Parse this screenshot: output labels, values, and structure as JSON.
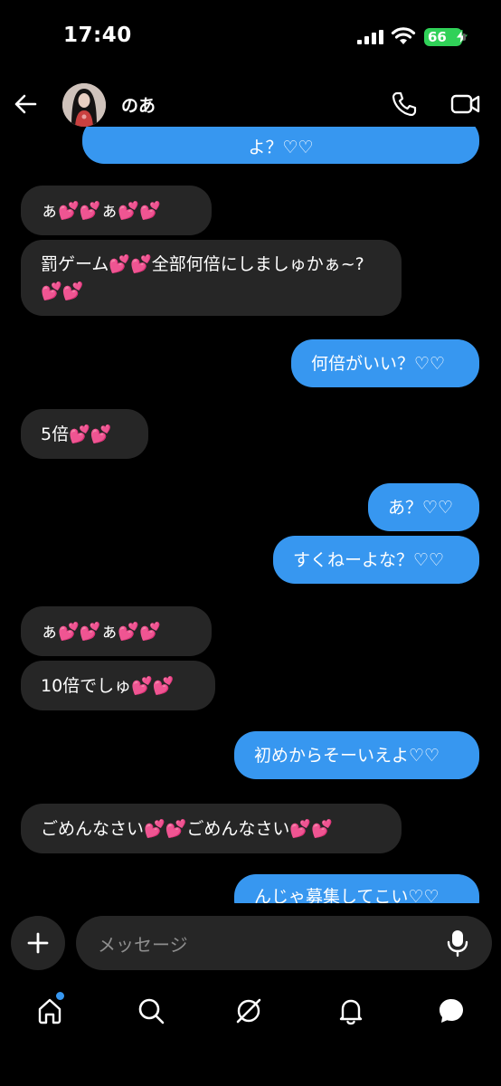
{
  "status_bar": {
    "time": "17:40",
    "battery": "66"
  },
  "header": {
    "contact_name": "のあ"
  },
  "messages": [
    {
      "dir": "out",
      "text": "よ？♡♡"
    },
    {
      "dir": "in",
      "text": "ぁ💕💕ぁ💕💕"
    },
    {
      "dir": "in",
      "text": "罰ゲーム💕💕全部何倍にしましゅかぁ~?💕💕"
    },
    {
      "dir": "out",
      "text": "何倍がいい？♡♡"
    },
    {
      "dir": "in",
      "text": "5倍💕💕"
    },
    {
      "dir": "out",
      "text": "あ？♡♡"
    },
    {
      "dir": "out",
      "text": "すくねーよな？♡♡"
    },
    {
      "dir": "in",
      "text": "ぁ💕💕ぁ💕💕"
    },
    {
      "dir": "in",
      "text": "10倍でしゅ💕💕"
    },
    {
      "dir": "out",
      "text": "初めからそーいえよ♡♡"
    },
    {
      "dir": "in",
      "text": "ごめんなさい💕💕ごめんなさい💕💕"
    },
    {
      "dir": "out",
      "text": "んじゃ募集してこい♡♡"
    }
  ],
  "composer": {
    "placeholder": "メッセージ"
  },
  "tab_bar": {
    "icons": [
      "home-icon",
      "search-icon",
      "explore-icon",
      "notifications-icon",
      "messages-icon"
    ]
  },
  "colors": {
    "outgoing_bubble": "#3797f0",
    "incoming_bubble": "#262626",
    "heart": "#ff4fb8",
    "battery": "#30d158"
  }
}
